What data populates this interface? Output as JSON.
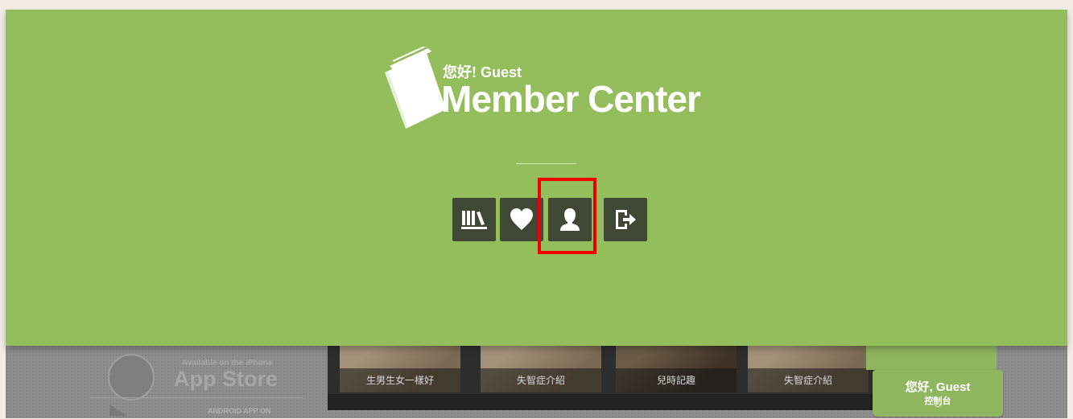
{
  "header": {
    "greeting": "您好! Guest",
    "title": "Member Center"
  },
  "toolbar": {
    "buttons": [
      {
        "name": "bookshelf",
        "icon": "bookshelf-icon"
      },
      {
        "name": "favorites",
        "icon": "heart-icon"
      },
      {
        "name": "profile",
        "icon": "user-icon",
        "highlighted": true
      },
      {
        "name": "logout",
        "icon": "logout-icon"
      }
    ]
  },
  "background": {
    "app_store_small": "Available on the iPhone",
    "app_store_big": "App Store",
    "android_text": "ANDROID APP ON",
    "shelf_items": [
      "生男生女一樣好",
      "失智症介紹",
      "兒時記趣",
      "失智症介紹"
    ]
  },
  "console": {
    "greeting": "您好, Guest",
    "label": "控制台",
    "chevron": "﹀"
  },
  "colors": {
    "overlay": "#94bd5b",
    "button_bg": "#3f4834",
    "highlight": "#ee0000",
    "page_bg": "#f3ece6"
  }
}
